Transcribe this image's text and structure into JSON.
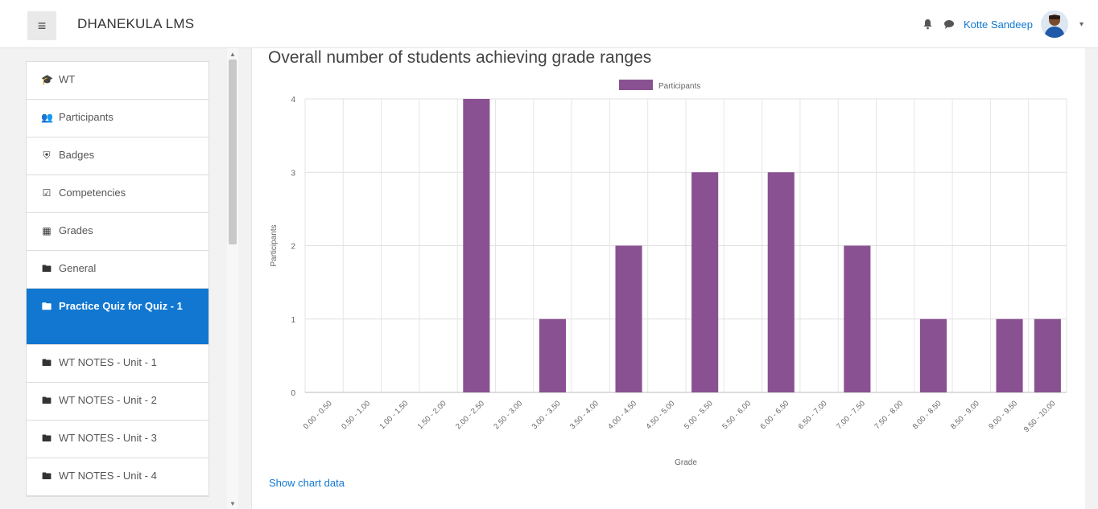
{
  "navbar": {
    "brand": "DHANEKULA LMS",
    "user_name": "Kotte Sandeep",
    "icons": [
      "menu-icon",
      "bell-icon",
      "chat-icon",
      "caret-down-icon"
    ]
  },
  "nav": {
    "items": [
      {
        "label": "WT",
        "icon": "graduation-cap-icon"
      },
      {
        "label": "Participants",
        "icon": "users-icon"
      },
      {
        "label": "Badges",
        "icon": "shield-icon"
      },
      {
        "label": "Competencies",
        "icon": "checkbox-icon"
      },
      {
        "label": "Grades",
        "icon": "table-icon"
      },
      {
        "label": "General",
        "icon": "folder-icon"
      },
      {
        "label": "Practice Quiz for Quiz - 1",
        "icon": "folder-icon",
        "active": true
      },
      {
        "label": "WT NOTES - Unit - 1",
        "icon": "folder-icon"
      },
      {
        "label": "WT NOTES - Unit - 2",
        "icon": "folder-icon"
      },
      {
        "label": "WT NOTES - Unit - 3",
        "icon": "folder-icon"
      },
      {
        "label": "WT NOTES - Unit - 4",
        "icon": "folder-icon"
      }
    ]
  },
  "main": {
    "title": "Overall number of students achieving grade ranges",
    "show_chart_data": "Show chart data"
  },
  "chart_data": {
    "type": "bar",
    "title": "Overall number of students achieving grade ranges",
    "xlabel": "Grade",
    "ylabel": "Participants",
    "categories": [
      "0.00 - 0.50",
      "0.50 - 1.00",
      "1.00 - 1.50",
      "1.50 - 2.00",
      "2.00 - 2.50",
      "2.50 - 3.00",
      "3.00 - 3.50",
      "3.50 - 4.00",
      "4.00 - 4.50",
      "4.50 - 5.00",
      "5.00 - 5.50",
      "5.50 - 6.00",
      "6.00 - 6.50",
      "6.50 - 7.00",
      "7.00 - 7.50",
      "7.50 - 8.00",
      "8.00 - 8.50",
      "8.50 - 9.00",
      "9.00 - 9.50",
      "9.50 - 10.00"
    ],
    "series": [
      {
        "name": "Participants",
        "values": [
          0,
          0,
          0,
          0,
          4,
          0,
          1,
          0,
          2,
          0,
          3,
          0,
          3,
          0,
          2,
          0,
          1,
          0,
          1,
          1
        ]
      }
    ],
    "ylim": [
      0,
      4
    ],
    "yticks": [
      0,
      1,
      2,
      3,
      4
    ],
    "grid": true,
    "legend": "top-center",
    "color": "#8a5192"
  }
}
